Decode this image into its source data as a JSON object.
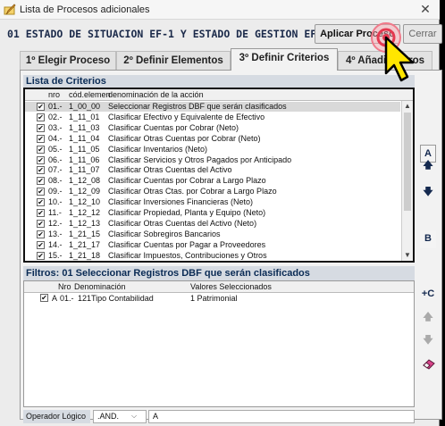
{
  "window": {
    "title": "Lista de Procesos adicionales",
    "close_glyph": "✕"
  },
  "header": {
    "text": "01 ESTADO DE SITUACION EF-1 Y ESTADO DE GESTION EF-2",
    "apply_label": "Aplicar Proceso",
    "cancel_label": "Cerrar"
  },
  "tabs": [
    {
      "label": "1º Elegir Proceso"
    },
    {
      "label": "2º Definir Elementos"
    },
    {
      "label": "3º Definir Criterios",
      "active": true
    },
    {
      "label": "4º Añadir Filtros"
    }
  ],
  "criteria": {
    "section_label": "Lista de Criterios",
    "headers": {
      "nro": "nro",
      "cod": "cód.elemen",
      "den": "denominación de la acción"
    },
    "rows": [
      {
        "check": "✔",
        "nro": "01.-",
        "cod": "1_00_00",
        "den": "Seleccionar Registros DBF que serán clasificados"
      },
      {
        "check": "✔",
        "nro": "02.-",
        "cod": "1_11_01",
        "den": "Clasificar Efectivo y Equivalente de Efectivo"
      },
      {
        "check": "✔",
        "nro": "03.-",
        "cod": "1_11_03",
        "den": "Clasificar Cuentas por Cobrar (Neto)"
      },
      {
        "check": "✔",
        "nro": "04.-",
        "cod": "1_11_04",
        "den": "Clasificar Otras Cuentas por Cobrar (Neto)"
      },
      {
        "check": "✔",
        "nro": "05.-",
        "cod": "1_11_05",
        "den": "Clasificar Inventarios (Neto)"
      },
      {
        "check": "✔",
        "nro": "06.-",
        "cod": "1_11_06",
        "den": "Clasificar Servicios y Otros Pagados por Anticipado"
      },
      {
        "check": "✔",
        "nro": "07.-",
        "cod": "1_11_07",
        "den": "Clasificar Otras Cuentas del Activo"
      },
      {
        "check": "✔",
        "nro": "08.-",
        "cod": "1_12_08",
        "den": "Clasificar Cuentas por Cobrar a Largo Plazo"
      },
      {
        "check": "✔",
        "nro": "09.-",
        "cod": "1_12_09",
        "den": "Clasificar Otras Ctas. por Cobrar a Largo Plazo"
      },
      {
        "check": "✔",
        "nro": "10.-",
        "cod": "1_12_10",
        "den": "Clasificar Inversiones Financieras (Neto)"
      },
      {
        "check": "✔",
        "nro": "11.-",
        "cod": "1_12_12",
        "den": "Clasificar Propiedad, Planta y Equipo (Neto)"
      },
      {
        "check": "✔",
        "nro": "12.-",
        "cod": "1_12_13",
        "den": "Clasificar Otras Cuentas del Activo (Neto)"
      },
      {
        "check": "✔",
        "nro": "13.-",
        "cod": "1_21_15",
        "den": "Clasificar Sobregiros Bancarios"
      },
      {
        "check": "✔",
        "nro": "14.-",
        "cod": "1_21_17",
        "den": "Clasificar Cuentas por Pagar a Proveedores"
      },
      {
        "check": "✔",
        "nro": "15.-",
        "cod": "1_21_18",
        "den": "Clasificar Impuestos, Contribuciones y Otros"
      }
    ]
  },
  "side_buttons": {
    "a": "A",
    "up": "🡅",
    "down": "🡇",
    "b": "B",
    "plus_c": "+C",
    "up2": "🡅",
    "down2": "🡇"
  },
  "filters": {
    "section_label": "Filtros: 01 Seleccionar Registros DBF que serán clasificados",
    "headers": {
      "nro": "Nro",
      "den": "Denominación",
      "val": "Valores Seleccionados"
    },
    "rows": [
      {
        "check": "✔",
        "flag": "A",
        "nro": "01.-",
        "code": "121",
        "den": "Tipo Contabilidad",
        "val": "1 Patrimonial"
      }
    ]
  },
  "operator": {
    "label": "Operador Lógico",
    "value": ".AND.",
    "value2": "A"
  }
}
